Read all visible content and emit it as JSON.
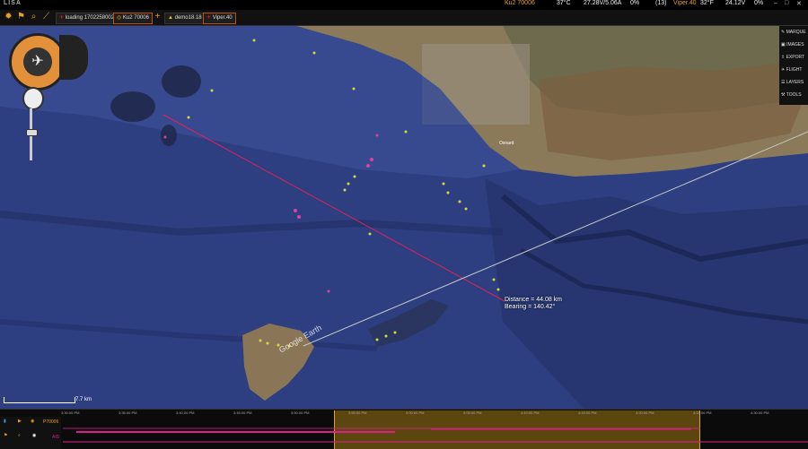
{
  "app": {
    "title": "LISA"
  },
  "status": {
    "ku2": "Ku2 70006",
    "temp": "37°C",
    "power": "27.28V/5.06A",
    "signal": "0%",
    "count": "(13)",
    "viper": "Viper.40",
    "viper_temp": "32°F",
    "voltage": "24.12V",
    "pct": "0%"
  },
  "toolbar": {
    "tabs": [
      "loading 1702258002",
      "Ku2 70006",
      "demo18.18",
      "Viper.40"
    ]
  },
  "side_menu": {
    "items": [
      "MARQUE",
      "IMAGES",
      "EXPORT",
      "FLIGHT",
      "LAYERS",
      "TOOLS"
    ]
  },
  "map": {
    "measure_distance": "Distance = 44.08 km",
    "measure_bearing": "Bearing = 140.42°",
    "scale": "7.7 km",
    "watermark": "Google Earth",
    "place_label": "Oxnard"
  },
  "timeline": {
    "ticks": [
      "3:30:00 PM",
      "3:35:00 PM",
      "3:40:00 PM",
      "3:45:00 PM",
      "3:50:00 PM",
      "3:55:00 PM",
      "4:00:00 PM",
      "4:05:00 PM",
      "4:10:00 PM",
      "4:15:00 PM",
      "4:20:00 PM",
      "4:25:00 PM",
      "4:30:00 PM"
    ],
    "track1": "P70006",
    "track2": "AIS"
  },
  "colors": {
    "accent": "#e8a020",
    "track": "#e0208a",
    "highlight": "#a07814"
  }
}
